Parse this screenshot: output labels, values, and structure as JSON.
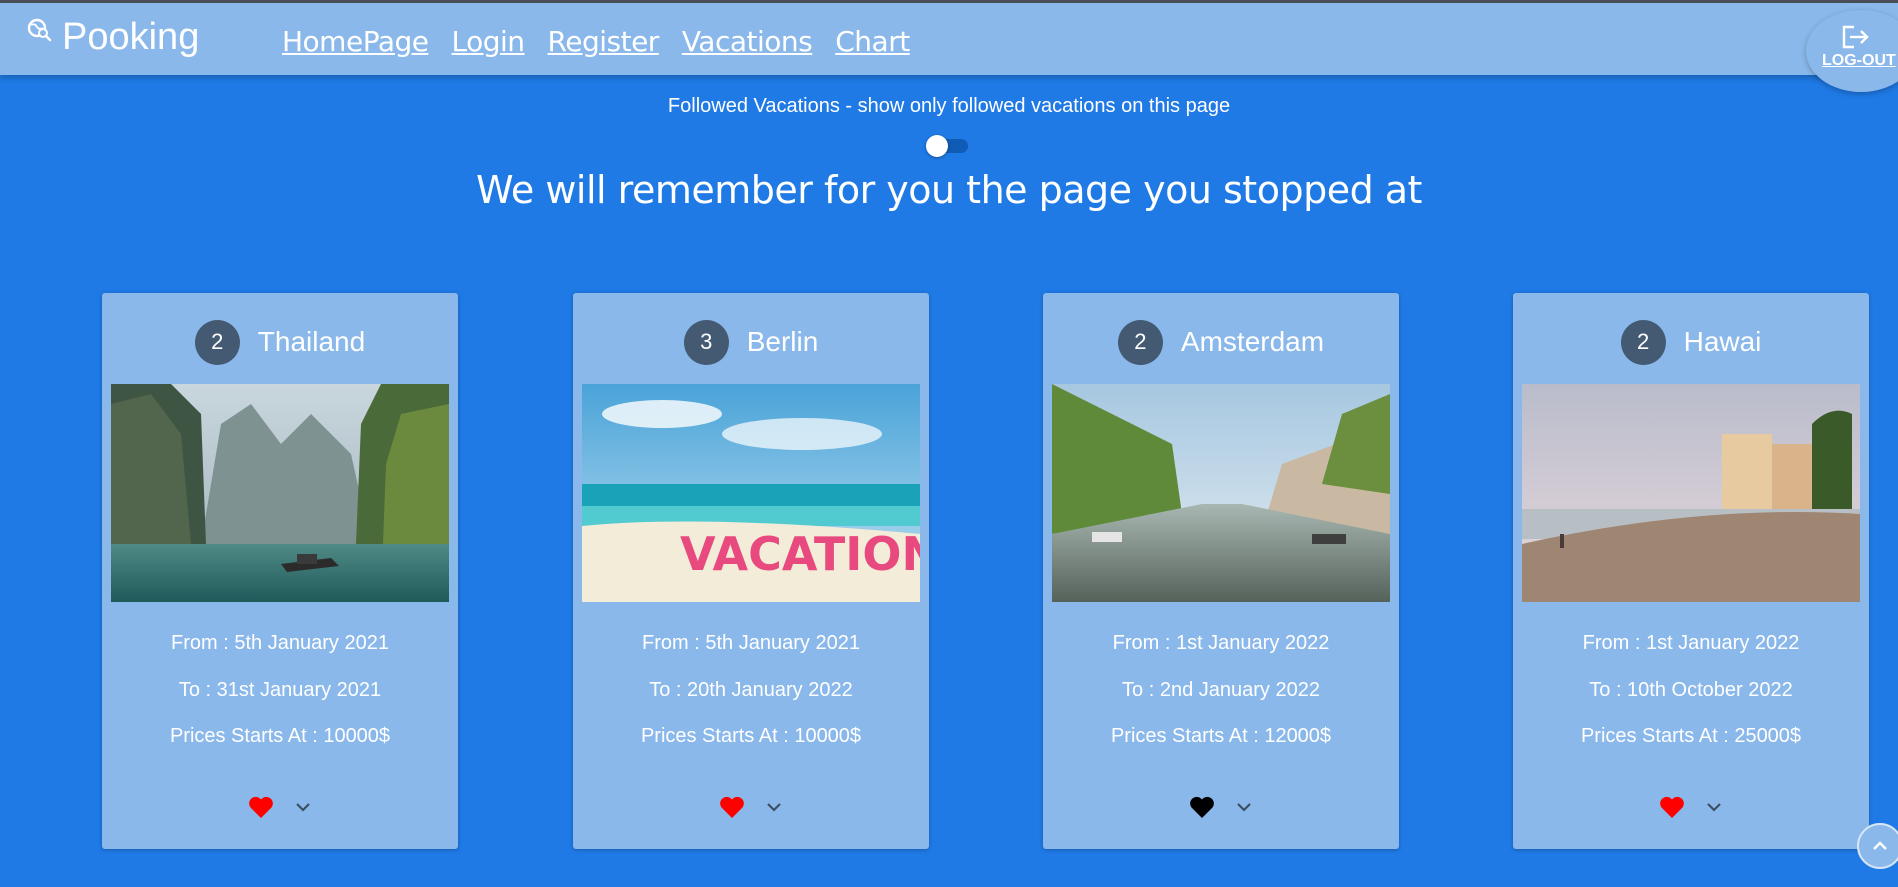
{
  "brand": {
    "name": "Pooking",
    "icon": "globe-search-icon"
  },
  "nav": {
    "links": [
      {
        "label": "HomePage"
      },
      {
        "label": "Login"
      },
      {
        "label": "Register"
      },
      {
        "label": "Vacations"
      },
      {
        "label": "Chart"
      }
    ],
    "logout": {
      "label": "LOG-OUT",
      "icon": "logout-icon"
    }
  },
  "filter": {
    "label": "Followed Vacations - show only followed vacations on this page",
    "toggle_on": false
  },
  "headline": "We will remember for you the page you stopped at",
  "cards": [
    {
      "followers": "2",
      "destination": "Thailand",
      "from": "From : 5th January 2021",
      "to": "To : 31st January 2021",
      "price": "Prices Starts At : 10000$",
      "followed": true,
      "heart_color": "#ff0000",
      "image": "thailand-lagoon-photo"
    },
    {
      "followers": "3",
      "destination": "Berlin",
      "from": "From : 5th January 2021",
      "to": "To : 20th January 2022",
      "price": "Prices Starts At : 10000$",
      "followed": true,
      "heart_color": "#ff0000",
      "image": "vacation-beach-photo",
      "image_text": "VACATION"
    },
    {
      "followers": "2",
      "destination": "Amsterdam",
      "from": "From : 1st January 2022",
      "to": "To : 2nd January 2022",
      "price": "Prices Starts At : 12000$",
      "followed": false,
      "heart_color": "#000000",
      "image": "amsterdam-canal-photo"
    },
    {
      "followers": "2",
      "destination": "Hawai",
      "from": "From : 1st January 2022",
      "to": "To : 10th October 2022",
      "price": "Prices Starts At : 25000$",
      "followed": true,
      "heart_color": "#ff0000",
      "image": "hawaii-beach-photo"
    }
  ],
  "colors": {
    "background": "#1f7ae6",
    "navbar": "#8ab8ea",
    "card": "#8ab8ea",
    "badge": "#445a73"
  }
}
